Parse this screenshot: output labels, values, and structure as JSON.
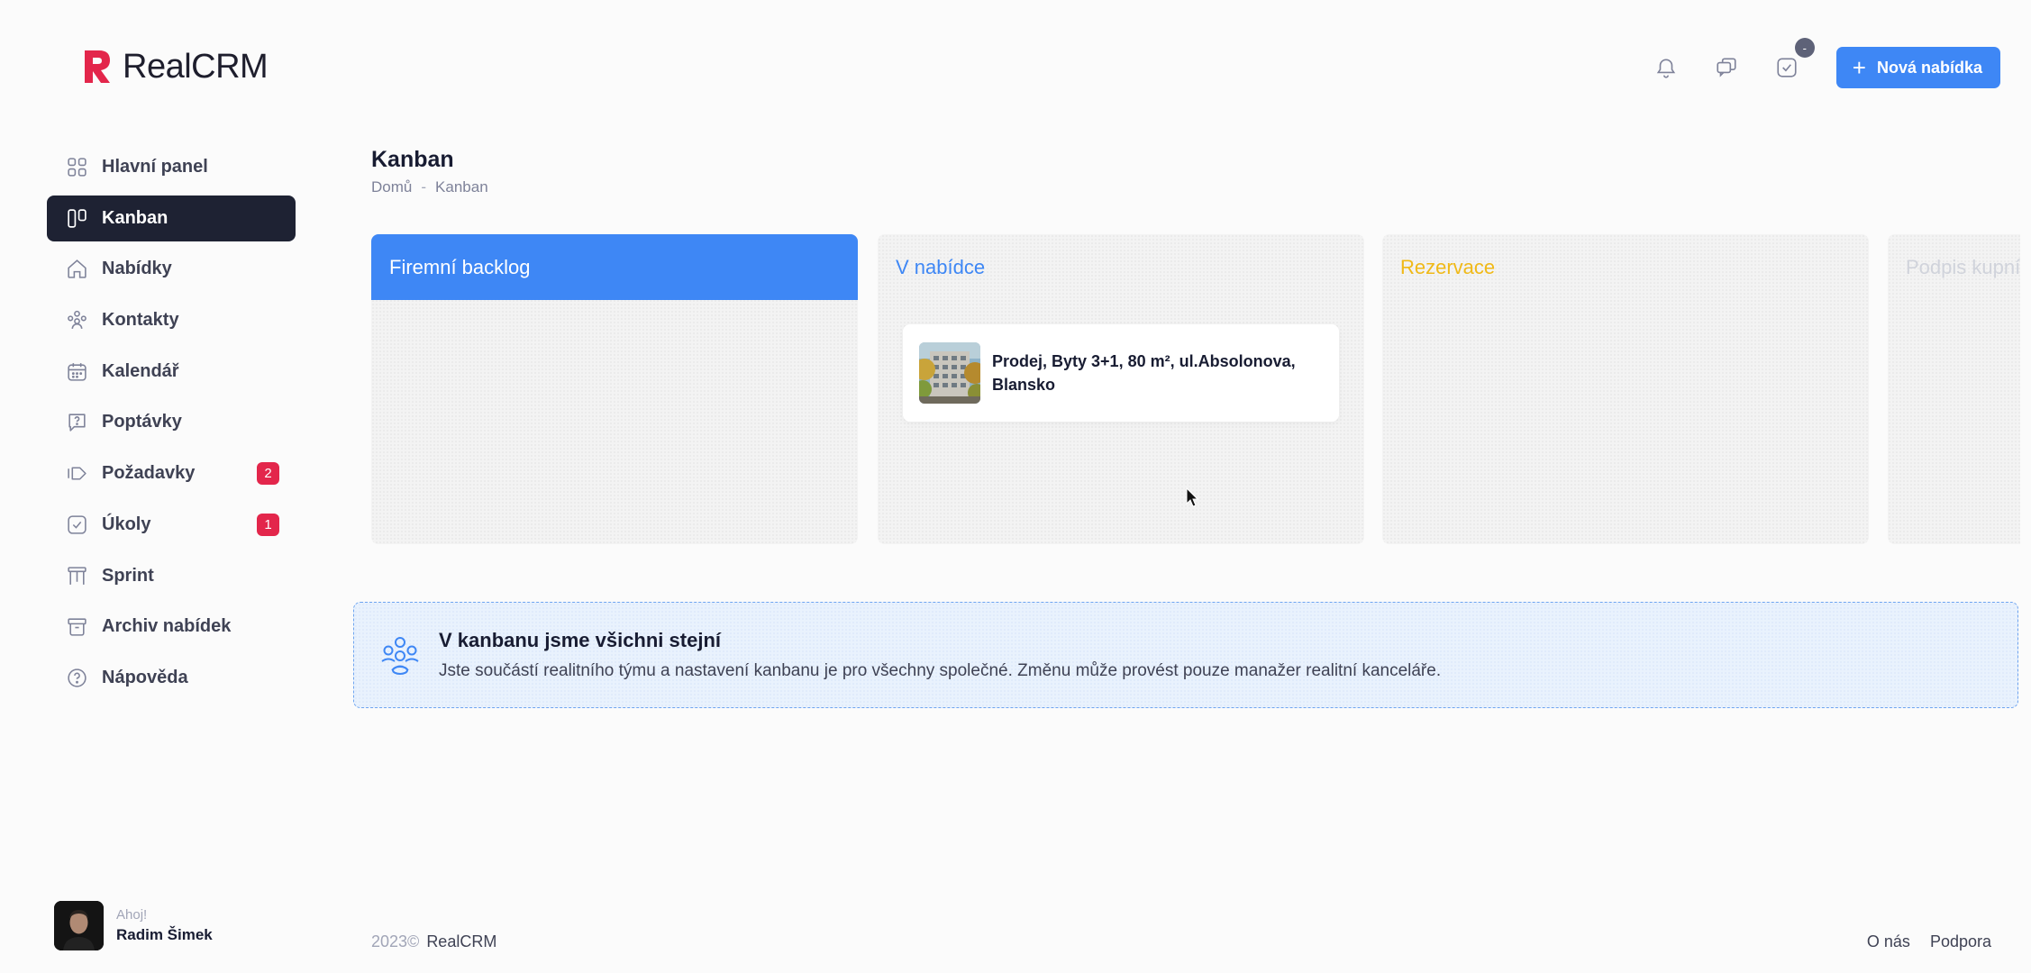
{
  "brand": {
    "name": "RealCRM"
  },
  "header": {
    "new_offer_label": "Nová nabídka",
    "tasks_badge": "-"
  },
  "sidebar": {
    "items": [
      {
        "label": "Hlavní panel",
        "icon": "grid-icon"
      },
      {
        "label": "Kanban",
        "icon": "kanban-icon",
        "active": true
      },
      {
        "label": "Nabídky",
        "icon": "home-icon"
      },
      {
        "label": "Kontakty",
        "icon": "people-icon"
      },
      {
        "label": "Kalendář",
        "icon": "calendar-icon"
      },
      {
        "label": "Poptávky",
        "icon": "question-chat-icon"
      },
      {
        "label": "Požadavky",
        "icon": "forward-icon",
        "badge": "2"
      },
      {
        "label": "Úkoly",
        "icon": "check-icon",
        "badge": "1"
      },
      {
        "label": "Sprint",
        "icon": "sprint-icon"
      },
      {
        "label": "Archiv nabídek",
        "icon": "archive-icon"
      },
      {
        "label": "Nápověda",
        "icon": "help-icon"
      }
    ]
  },
  "user": {
    "greeting": "Ahoj!",
    "name": "Radim Šimek"
  },
  "page": {
    "title": "Kanban",
    "breadcrumb": {
      "home": "Domů",
      "separator": "-",
      "current": "Kanban"
    }
  },
  "board": {
    "columns": [
      {
        "title": "Firemní backlog",
        "color": "#3e87f5"
      },
      {
        "title": "V nabídce",
        "color": "#3e87f5",
        "cards": [
          {
            "title_line1": "Prodej, Byty 3+1, 80 m², ul.Absolonova,",
            "title_line2": "Blansko"
          }
        ]
      },
      {
        "title": "Rezervace",
        "color": "#f0b917"
      },
      {
        "title": "Podpis kupní smlouvy",
        "color": "#d0d3db"
      }
    ]
  },
  "info": {
    "title": "V kanbanu jsme všichni stejní",
    "text": "Jste součástí realitního týmu a nastavení kanbanu je pro všechny společné. Změnu může provést pouze manažer realitní kanceláře."
  },
  "footer": {
    "year": "2023©",
    "brand": "RealCRM",
    "links": [
      "O nás",
      "Podpora"
    ]
  },
  "colors": {
    "primary": "#3e87f5",
    "danger": "#e3264b",
    "dark": "#1e2233",
    "warning": "#f0b917"
  }
}
